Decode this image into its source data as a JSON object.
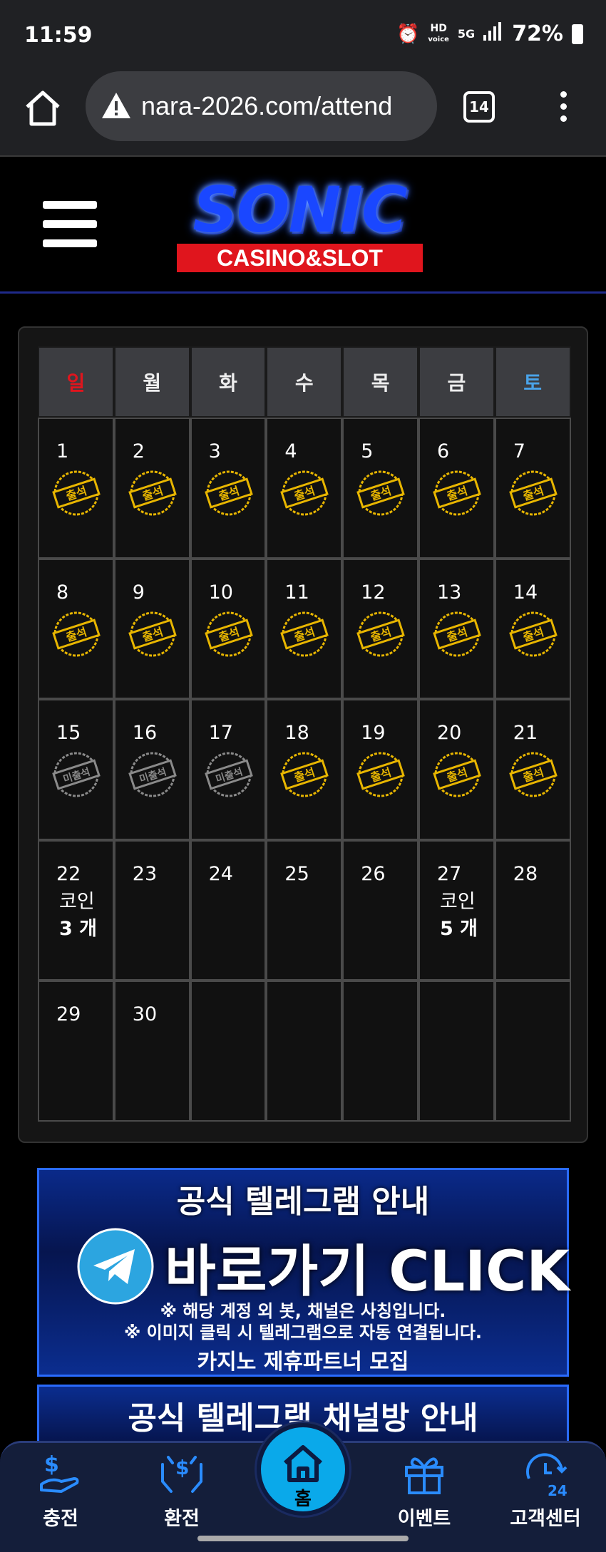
{
  "status_bar": {
    "time": "11:59",
    "alarm_icon": "alarm-icon",
    "hd_label": "HD",
    "voice_label": "voice",
    "network": "5G",
    "battery": "72%"
  },
  "browser": {
    "url": "nara-2026.com/attend",
    "tab_count": "14"
  },
  "site": {
    "logo_main": "SONIC",
    "logo_sub": "CASINO&SLOT"
  },
  "calendar": {
    "weekdays": [
      "일",
      "월",
      "화",
      "수",
      "목",
      "금",
      "토"
    ],
    "attend_label": "출석",
    "absent_label": "미출석",
    "coin_label": "코인",
    "weeks": [
      [
        {
          "day": "1",
          "status": "attend"
        },
        {
          "day": "2",
          "status": "attend"
        },
        {
          "day": "3",
          "status": "attend"
        },
        {
          "day": "4",
          "status": "attend"
        },
        {
          "day": "5",
          "status": "attend"
        },
        {
          "day": "6",
          "status": "attend"
        },
        {
          "day": "7",
          "status": "attend"
        }
      ],
      [
        {
          "day": "8",
          "status": "attend"
        },
        {
          "day": "9",
          "status": "attend"
        },
        {
          "day": "10",
          "status": "attend"
        },
        {
          "day": "11",
          "status": "attend"
        },
        {
          "day": "12",
          "status": "attend"
        },
        {
          "day": "13",
          "status": "attend"
        },
        {
          "day": "14",
          "status": "attend"
        }
      ],
      [
        {
          "day": "15",
          "status": "absent"
        },
        {
          "day": "16",
          "status": "absent"
        },
        {
          "day": "17",
          "status": "absent"
        },
        {
          "day": "18",
          "status": "attend"
        },
        {
          "day": "19",
          "status": "attend"
        },
        {
          "day": "20",
          "status": "attend"
        },
        {
          "day": "21",
          "status": "attend"
        }
      ],
      [
        {
          "day": "22",
          "status": "coin",
          "coin_count": "3 개"
        },
        {
          "day": "23",
          "status": "none"
        },
        {
          "day": "24",
          "status": "none"
        },
        {
          "day": "25",
          "status": "none"
        },
        {
          "day": "26",
          "status": "none"
        },
        {
          "day": "27",
          "status": "coin",
          "coin_count": "5 개"
        },
        {
          "day": "28",
          "status": "none"
        }
      ],
      [
        {
          "day": "29",
          "status": "none"
        },
        {
          "day": "30",
          "status": "none"
        },
        {
          "day": "",
          "status": "none"
        },
        {
          "day": "",
          "status": "none"
        },
        {
          "day": "",
          "status": "none"
        },
        {
          "day": "",
          "status": "none"
        },
        {
          "day": "",
          "status": "none"
        }
      ]
    ]
  },
  "banner1": {
    "title": "공식 텔레그램 안내",
    "click_text": "바로가기 CLICK",
    "note1": "※ 해당 계정 외 봇, 채널은 사칭입니다.",
    "note2": "※ 이미지 클릭 시 텔레그램으로 자동 연결됩니다.",
    "partner": "카지노 제휴파트너 모집"
  },
  "banner2": {
    "title": "공식 텔레그램 채널방 안내"
  },
  "bottom_nav": {
    "items": [
      {
        "label": "충전",
        "icon": "deposit-icon"
      },
      {
        "label": "환전",
        "icon": "withdraw-icon"
      },
      {
        "label": "홈",
        "icon": "home-icon"
      },
      {
        "label": "이벤트",
        "icon": "gift-icon"
      },
      {
        "label": "고객센터",
        "icon": "support-24-icon"
      }
    ]
  },
  "colors": {
    "sunday": "#e0151d",
    "saturday": "#4aa3e8",
    "stamp_attend": "#e8b600",
    "stamp_absent": "#8a8a8a",
    "home_button": "#0aa9ea",
    "nav_bg": "#141e3a"
  }
}
